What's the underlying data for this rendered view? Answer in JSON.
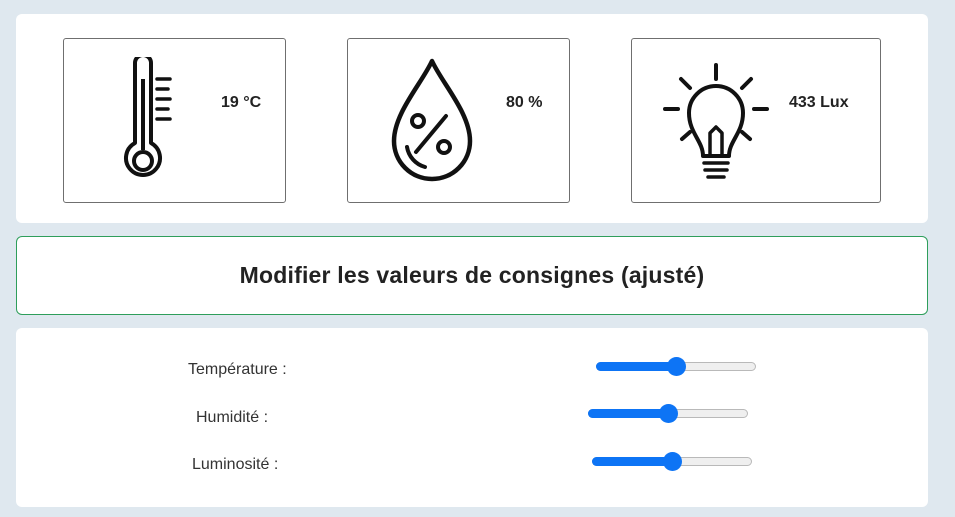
{
  "sensors": {
    "temperature": {
      "icon": "thermometer-icon",
      "value": "19 °C"
    },
    "humidity": {
      "icon": "humidity-percent-drop-icon",
      "value": "80 %"
    },
    "luminosity": {
      "icon": "light-bulb-icon",
      "value": "433 Lux"
    }
  },
  "setpoints": {
    "title": "Modifier les valeurs de consignes (ajusté)",
    "items": [
      {
        "label": "Température :",
        "level": 0.5
      },
      {
        "label": "Humidité :",
        "level": 0.5
      },
      {
        "label": "Luminosité :",
        "level": 0.5
      }
    ]
  },
  "colors": {
    "accent": "#0d74f5",
    "title_border": "#2e9e5b",
    "background": "#dfe8ef"
  }
}
